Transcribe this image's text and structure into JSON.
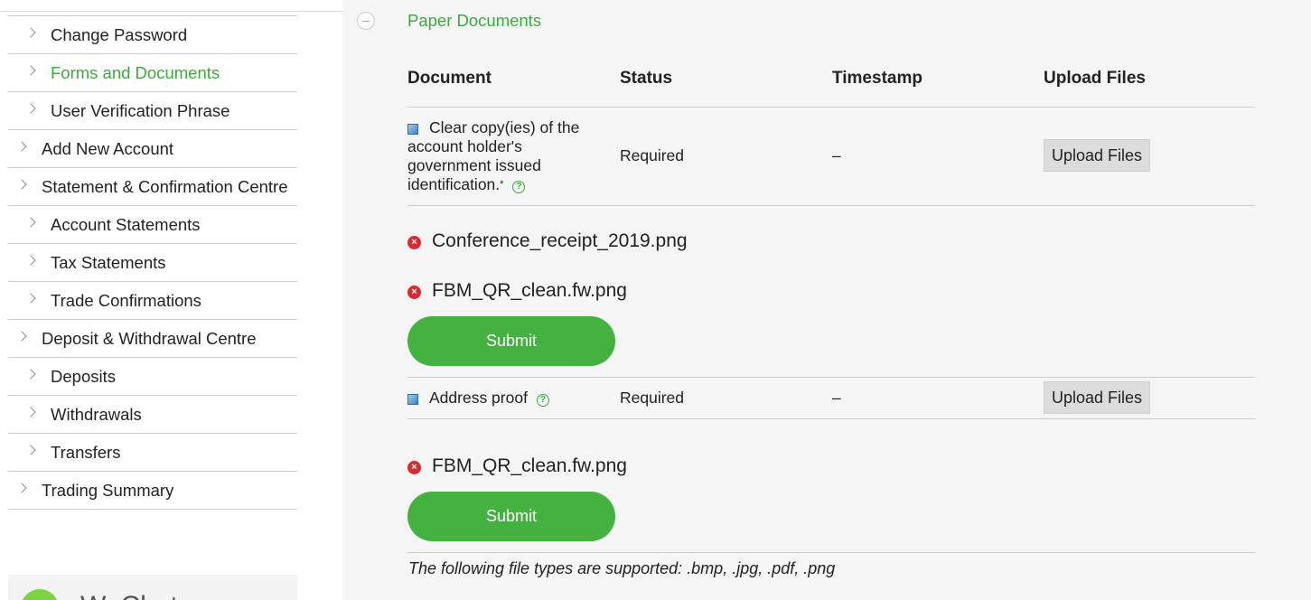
{
  "sidebar": {
    "items": [
      {
        "label": "Change Password",
        "level": "sub",
        "active": false
      },
      {
        "label": "Forms and Documents",
        "level": "sub",
        "active": true
      },
      {
        "label": "User Verification Phrase",
        "level": "sub",
        "active": false
      },
      {
        "label": "Add New Account",
        "level": "top",
        "active": false
      },
      {
        "label": "Statement & Confirmation Centre",
        "level": "top",
        "active": false
      },
      {
        "label": "Account Statements",
        "level": "sub",
        "active": false
      },
      {
        "label": "Tax Statements",
        "level": "sub",
        "active": false
      },
      {
        "label": "Trade Confirmations",
        "level": "sub",
        "active": false
      },
      {
        "label": "Deposit & Withdrawal Centre",
        "level": "top",
        "active": false
      },
      {
        "label": "Deposits",
        "level": "sub",
        "active": false
      },
      {
        "label": "Withdrawals",
        "level": "sub",
        "active": false
      },
      {
        "label": "Transfers",
        "level": "sub",
        "active": false
      },
      {
        "label": "Trading Summary",
        "level": "top",
        "active": false
      }
    ],
    "wechat_label": "WeChat"
  },
  "section": {
    "title": "Paper Documents"
  },
  "table": {
    "headers": [
      "Document",
      "Status",
      "Timestamp",
      "Upload Files"
    ],
    "rows": [
      {
        "document": "Clear copy(ies) of the account holder's government issued identification.",
        "required_mark": "*",
        "status": "Required",
        "timestamp": "–",
        "upload_label": "Upload Files",
        "files": [
          "Conference_receipt_2019.png",
          "FBM_QR_clean.fw.png"
        ],
        "submit_label": "Submit"
      },
      {
        "document": "Address proof",
        "status": "Required",
        "timestamp": "–",
        "upload_label": "Upload Files",
        "files": [
          "FBM_QR_clean.fw.png"
        ],
        "submit_label": "Submit"
      }
    ]
  },
  "footnote": "The following file types are supported: .bmp, .jpg, .pdf, .png",
  "icons": {
    "help": "?",
    "remove": "×"
  },
  "colors": {
    "accent_green": "#3aab3a",
    "submit_green": "#44b241",
    "remove_red": "#e0282c"
  }
}
